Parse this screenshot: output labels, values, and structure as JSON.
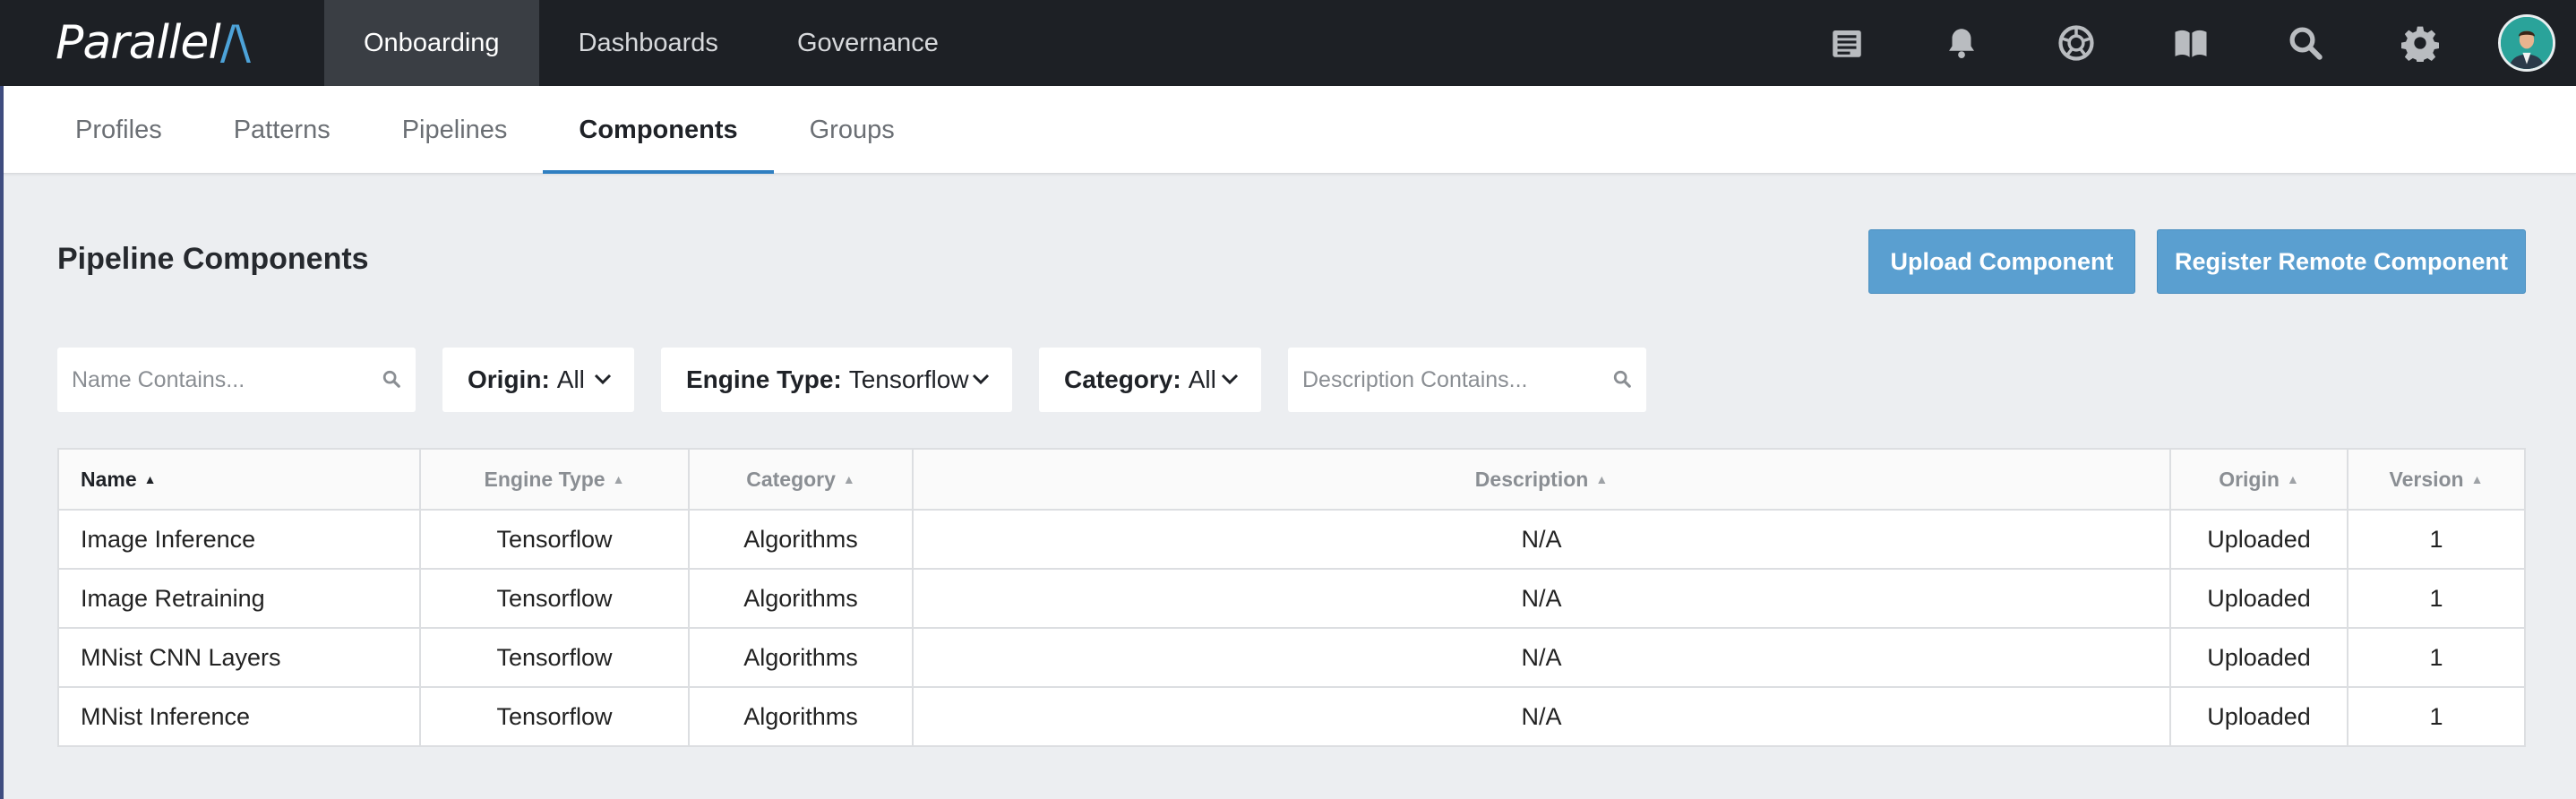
{
  "app": {
    "logo_text": "Parallel",
    "logo_accent": "/\\",
    "top_nav": [
      "Onboarding",
      "Dashboards",
      "Governance"
    ],
    "top_nav_active": "Onboarding",
    "top_icons": [
      "document-icon",
      "bell-icon",
      "aperture-icon",
      "book-icon",
      "search-icon",
      "gear-icon"
    ]
  },
  "sub_nav": {
    "items": [
      "Profiles",
      "Patterns",
      "Pipelines",
      "Components",
      "Groups"
    ],
    "active": "Components"
  },
  "page": {
    "title": "Pipeline Components",
    "upload_button": "Upload Component",
    "register_button": "Register Remote Component"
  },
  "filters": {
    "name_placeholder": "Name Contains...",
    "origin_label": "Origin:",
    "origin_value": "All",
    "engine_label": "Engine Type:",
    "engine_value": "Tensorflow",
    "category_label": "Category:",
    "category_value": "All",
    "description_placeholder": "Description Contains..."
  },
  "table": {
    "columns": [
      "Name",
      "Engine Type",
      "Category",
      "Description",
      "Origin",
      "Version"
    ],
    "rows": [
      [
        "Image Inference",
        "Tensorflow",
        "Algorithms",
        "N/A",
        "Uploaded",
        "1"
      ],
      [
        "Image Retraining",
        "Tensorflow",
        "Algorithms",
        "N/A",
        "Uploaded",
        "1"
      ],
      [
        "MNist CNN Layers",
        "Tensorflow",
        "Algorithms",
        "N/A",
        "Uploaded",
        "1"
      ],
      [
        "MNist Inference",
        "Tensorflow",
        "Algorithms",
        "N/A",
        "Uploaded",
        "1"
      ]
    ]
  },
  "colors": {
    "topbar": "#1d2025",
    "accent": "#2f7fc1",
    "button": "#5a9fd0"
  }
}
